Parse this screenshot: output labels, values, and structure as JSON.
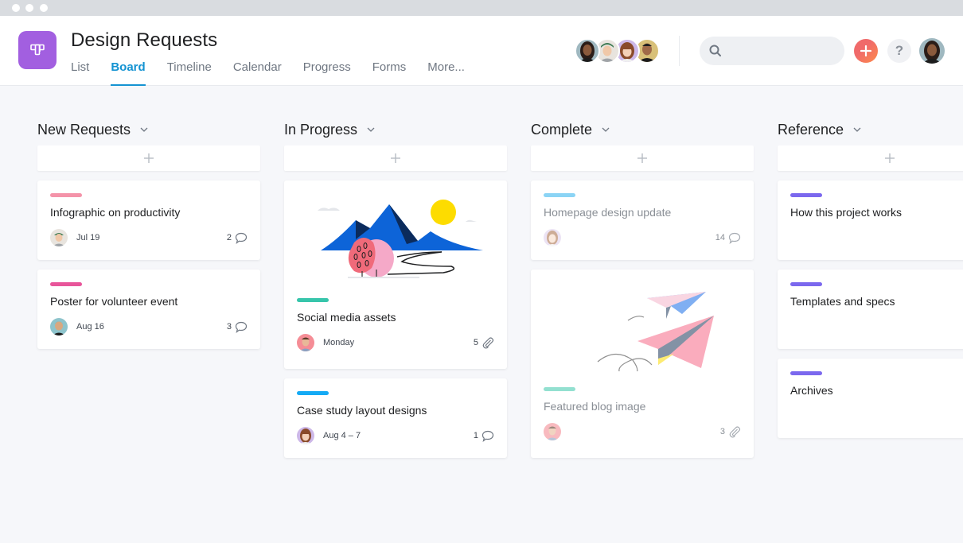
{
  "window": {
    "controls": [
      "close",
      "minimize",
      "maximize"
    ]
  },
  "header": {
    "project_title": "Design Requests",
    "project_icon": "board-icon",
    "project_color": "#a25fe0",
    "tabs": [
      {
        "label": "List",
        "active": false
      },
      {
        "label": "Board",
        "active": true
      },
      {
        "label": "Timeline",
        "active": false
      },
      {
        "label": "Calendar",
        "active": false
      },
      {
        "label": "Progress",
        "active": false
      },
      {
        "label": "Forms",
        "active": false
      },
      {
        "label": "More...",
        "active": false
      }
    ],
    "members": [
      "member-1",
      "member-2",
      "member-3",
      "member-4"
    ],
    "search": {
      "placeholder": "",
      "value": ""
    },
    "add_icon": "plus-icon",
    "help_label": "?",
    "accent_color": "#1493d2"
  },
  "columns": [
    {
      "title": "New Requests",
      "cards": [
        {
          "tag_color": "#f493a9",
          "title": "Infographic on productivity",
          "date": "Jul 19",
          "count": "2",
          "count_icon": "comment-icon",
          "complete": false
        },
        {
          "tag_color": "#e8559a",
          "title": "Poster for volunteer event",
          "date": "Aug 16",
          "count": "3",
          "count_icon": "comment-icon",
          "complete": false
        }
      ]
    },
    {
      "title": "In Progress",
      "cards": [
        {
          "tag_color": "#37c5ab",
          "title": "Social media assets",
          "date": "Monday",
          "count": "5",
          "count_icon": "attachment-icon",
          "complete": false,
          "image": "mountain-illustration"
        },
        {
          "tag_color": "#14aaf5",
          "title": "Case study layout designs",
          "date": "Aug 4 – 7",
          "count": "1",
          "count_icon": "comment-icon",
          "complete": false
        }
      ]
    },
    {
      "title": "Complete",
      "cards": [
        {
          "tag_color": "#8bd4f5",
          "title": "Homepage design update",
          "date": "",
          "count": "14",
          "count_icon": "comment-icon",
          "complete": true
        },
        {
          "tag_color": "#93e0d0",
          "title": "Featured blog image",
          "date": "",
          "count": "3",
          "count_icon": "attachment-icon",
          "complete": true,
          "image": "paper-plane-illustration"
        }
      ]
    },
    {
      "title": "Reference",
      "cards": [
        {
          "tag_color": "#7b68ee",
          "title": "How this project works"
        },
        {
          "tag_color": "#7b68ee",
          "title": "Templates and specs"
        },
        {
          "tag_color": "#7b68ee",
          "title": "Archives"
        }
      ]
    }
  ]
}
